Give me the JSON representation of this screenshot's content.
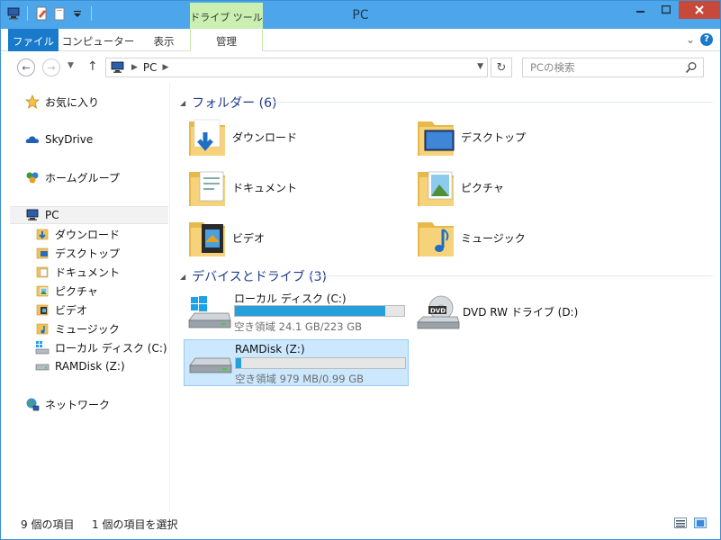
{
  "window": {
    "title": "PC"
  },
  "qat": {
    "icons": [
      "pc-icon",
      "properties-icon",
      "new-folder-icon",
      "dropdown-icon"
    ]
  },
  "ribbon": {
    "context_group": "ドライブ ツール",
    "tabs": [
      {
        "label": "ファイル"
      },
      {
        "label": "コンピューター"
      },
      {
        "label": "表示"
      },
      {
        "label": "管理"
      }
    ]
  },
  "address": {
    "location": "PC",
    "search_placeholder": "PCの検索"
  },
  "nav": {
    "favorites": "お気に入り",
    "skydrive": "SkyDrive",
    "homegroup": "ホームグループ",
    "pc": "PC",
    "pc_children": [
      "ダウンロード",
      "デスクトップ",
      "ドキュメント",
      "ピクチャ",
      "ビデオ",
      "ミュージック",
      "ローカル ディスク (C:)",
      "RAMDisk (Z:)"
    ],
    "network": "ネットワーク"
  },
  "folders": {
    "header": "フォルダー (6)",
    "items": [
      {
        "label": "ダウンロード",
        "icon": "downloads-folder-icon"
      },
      {
        "label": "デスクトップ",
        "icon": "desktop-folder-icon"
      },
      {
        "label": "ドキュメント",
        "icon": "documents-folder-icon"
      },
      {
        "label": "ピクチャ",
        "icon": "pictures-folder-icon"
      },
      {
        "label": "ビデオ",
        "icon": "videos-folder-icon"
      },
      {
        "label": "ミュージック",
        "icon": "music-folder-icon"
      }
    ]
  },
  "devices": {
    "header": "デバイスとドライブ (3)",
    "items": [
      {
        "name": "ローカル ディスク (C:)",
        "free": "空き領域 24.1 GB/223 GB",
        "used_fraction": 0.89
      },
      {
        "name": "DVD RW ドライブ (D:)"
      },
      {
        "name": "RAMDisk (Z:)",
        "free": "空き領域 979 MB/0.99 GB",
        "used_fraction": 0.03
      }
    ]
  },
  "status": {
    "count": "9 個の項目",
    "selection": "1 個の項目を選択"
  },
  "colors": {
    "accent": "#1979ca",
    "title_bar": "#4ea6ea",
    "context_tab": "#c9f0b0",
    "drive_bar": "#26a0da",
    "selection": "#cce8ff"
  }
}
